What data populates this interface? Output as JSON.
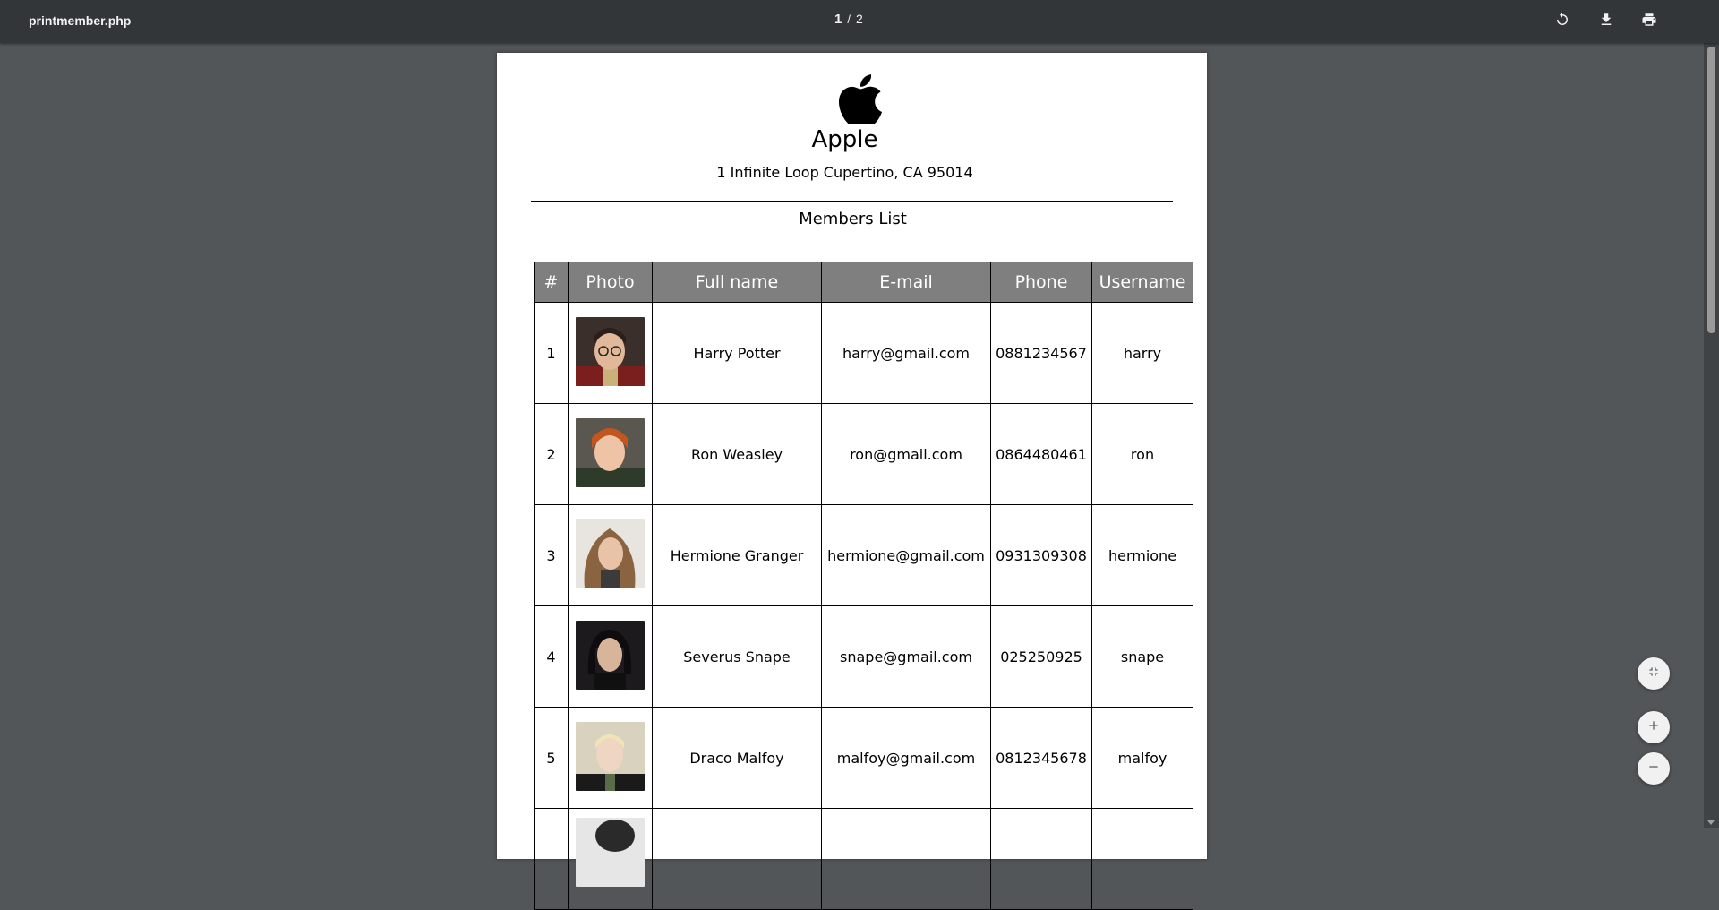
{
  "toolbar": {
    "title": "printmember.php",
    "current_page": "1",
    "separator": "/",
    "total_pages": "2",
    "rotate_icon": "rotate-icon",
    "download_icon": "download-icon",
    "print_icon": "print-icon"
  },
  "document": {
    "company_name": "Apple",
    "company_address": "1 Infinite Loop Cupertino, CA 95014",
    "list_title": "Members List",
    "columns": [
      "#",
      "Photo",
      "Full name",
      "E-mail",
      "Phone",
      "Username"
    ],
    "members": [
      {
        "no": "1",
        "full_name": "Harry Potter",
        "email": "harry@gmail.com",
        "phone": "0881234567",
        "username": "harry"
      },
      {
        "no": "2",
        "full_name": "Ron Weasley",
        "email": "ron@gmail.com",
        "phone": "0864480461",
        "username": "ron"
      },
      {
        "no": "3",
        "full_name": "Hermione Granger",
        "email": "hermione@gmail.com",
        "phone": "0931309308",
        "username": "hermione"
      },
      {
        "no": "4",
        "full_name": "Severus Snape",
        "email": "snape@gmail.com",
        "phone": "025250925",
        "username": "snape"
      },
      {
        "no": "5",
        "full_name": "Draco Malfoy",
        "email": "malfoy@gmail.com",
        "phone": "0812345678",
        "username": "malfoy"
      },
      {
        "no": "",
        "full_name": "",
        "email": "",
        "phone": "",
        "username": ""
      }
    ]
  },
  "controls": {
    "fit_icon": "fit-to-page-icon",
    "zoom_in_icon": "zoom-in-icon",
    "zoom_out_icon": "zoom-out-icon"
  },
  "colors": {
    "toolbar_bg": "#323639",
    "viewer_bg": "#525659",
    "table_header_bg": "#7f7f7f"
  }
}
